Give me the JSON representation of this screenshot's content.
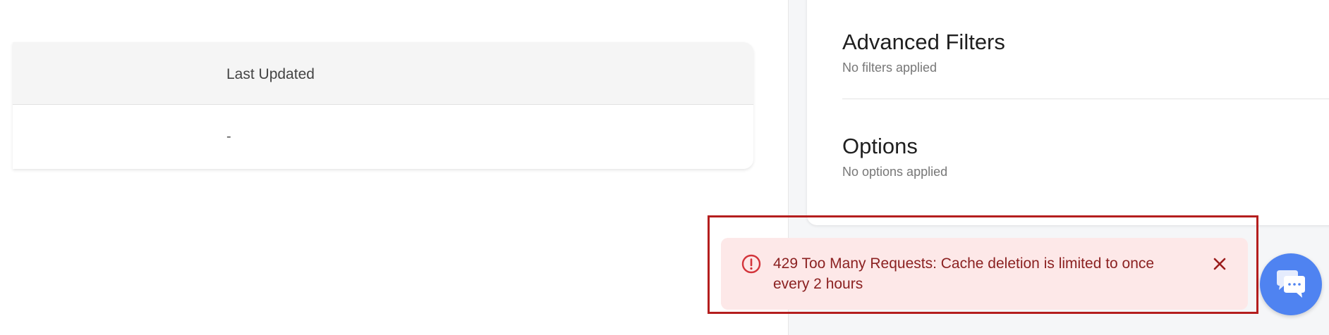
{
  "table": {
    "columns": [
      "Last Updated"
    ],
    "rows": [
      [
        "-"
      ]
    ]
  },
  "panel": {
    "advanced_filters": {
      "title": "Advanced Filters",
      "subtitle": "No filters applied",
      "icon": "chevron-down-icon"
    },
    "options": {
      "title": "Options",
      "subtitle": "No options applied",
      "icon": "chevron-down-icon"
    }
  },
  "toast": {
    "message": "429 Too Many Requests: Cache deletion is limited to once every 2 hours",
    "icon": "alert-circle-icon",
    "close_icon": "close-icon",
    "background_color": "#fde8e8",
    "text_color": "#8b2121",
    "highlight_color": "#b41e1e"
  },
  "chat": {
    "icon": "chat-icon",
    "color": "#4f83f1"
  }
}
